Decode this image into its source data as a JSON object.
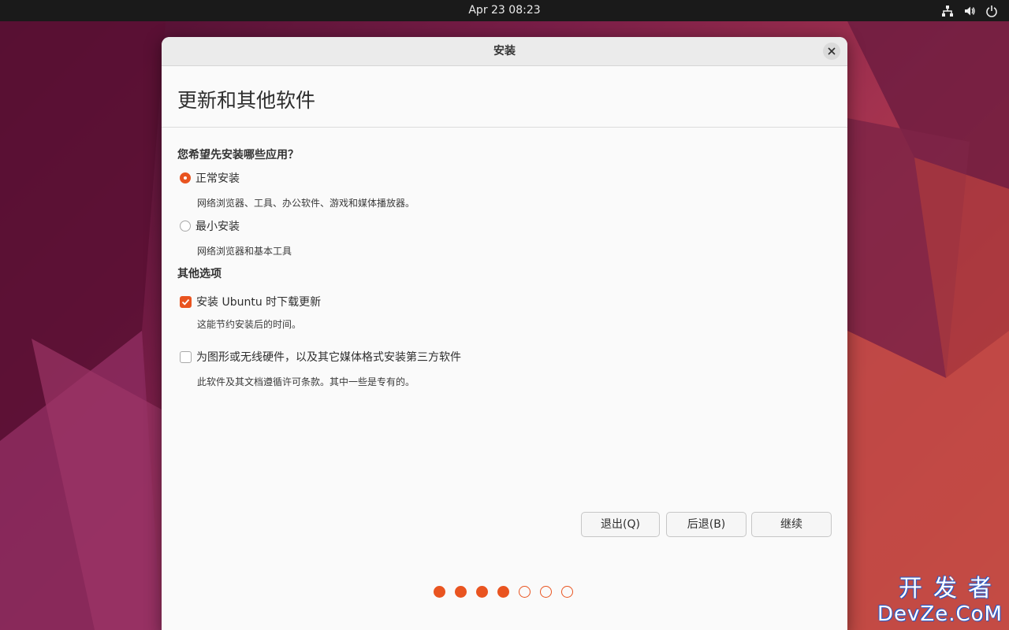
{
  "topbar": {
    "clock": "Apr 23  08:23",
    "tray_icons": [
      "network-icon",
      "volume-icon",
      "power-icon"
    ]
  },
  "window": {
    "title": "安装",
    "page_title": "更新和其他软件",
    "install_section": {
      "label": "您希望先安装哪些应用？",
      "options": [
        {
          "label": "正常安装",
          "description": "网络浏览器、工具、办公软件、游戏和媒体播放器。",
          "selected": true
        },
        {
          "label": "最小安装",
          "description": "网络浏览器和基本工具",
          "selected": false
        }
      ]
    },
    "other_section": {
      "label": "其他选项",
      "options": [
        {
          "label": "安装 Ubuntu 时下载更新",
          "description": "这能节约安装后的时间。",
          "checked": true
        },
        {
          "label": "为图形或无线硬件，以及其它媒体格式安装第三方软件",
          "description": "此软件及其文档遵循许可条款。其中一些是专有的。",
          "checked": false
        }
      ]
    },
    "buttons": {
      "quit": "退出(Q)",
      "back": "后退(B)",
      "continue": "继续"
    },
    "progress": {
      "total_steps": 7,
      "completed_steps": 4
    }
  },
  "watermark": {
    "line1": "开发者",
    "line2": "DevZe.CoM"
  },
  "colors": {
    "accent": "#e95420",
    "topbar": "#1a1a1a",
    "window_bg": "#fafafa"
  }
}
